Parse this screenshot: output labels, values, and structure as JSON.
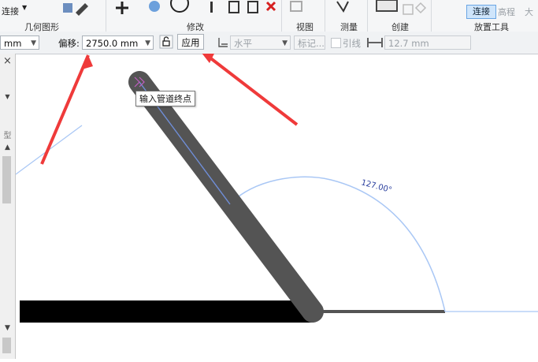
{
  "ribbon": {
    "connect_label": "连接",
    "tab_connect": "连接",
    "tab_elevation": "高程",
    "tab_more": "大",
    "groups": {
      "geometry": "几何图形",
      "modify": "修改",
      "view": "视图",
      "measure": "测量",
      "create": "创建",
      "placement_tools": "放置工具"
    }
  },
  "options_bar": {
    "unit_value": "mm",
    "offset_label": "偏移:",
    "offset_value": "2750.0 mm",
    "apply_label": "应用",
    "justify_value": "水平",
    "tag_button": "标记...",
    "leader_label": "引线",
    "leader_length": "12.7 mm"
  },
  "left_panel": {
    "close_glyph": "×",
    "type_char": "型"
  },
  "canvas": {
    "tooltip": "输入管道终点",
    "angle_text": "127.00°"
  },
  "colors": {
    "accent": "#ef3a3a",
    "pipe": "#545454",
    "guide": "#a9c7f5",
    "dim_text": "#2a3f9e"
  }
}
